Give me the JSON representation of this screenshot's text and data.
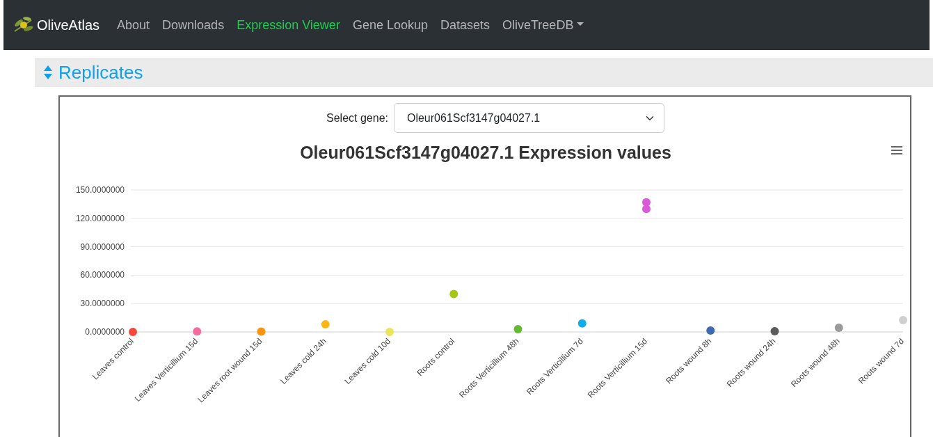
{
  "navbar": {
    "brand": "OliveAtlas",
    "links": [
      {
        "label": "About",
        "selected": false
      },
      {
        "label": "Downloads",
        "selected": false
      },
      {
        "label": "Expression Viewer",
        "selected": true
      },
      {
        "label": "Gene Lookup",
        "selected": false
      },
      {
        "label": "Datasets",
        "selected": false
      },
      {
        "label": "OliveTreeDB",
        "selected": false,
        "kind": "dropdown"
      }
    ]
  },
  "section": {
    "title": "Replicates"
  },
  "gene_select": {
    "label": "Select gene:",
    "value": "Oleur061Scf3147g04027.1"
  },
  "chart_data": {
    "type": "scatter",
    "title": "Oleur061Scf3147g04027.1 Expression values",
    "categories": [
      "Leaves control",
      "Leaves Verticillium 15d",
      "Leaves root wound 15d",
      "Leaves cold 24h",
      "Leaves cold 10d",
      "Roots control",
      "Roots Verticillium 48h",
      "Roots Verticillium 7d",
      "Roots Verticillium 15d",
      "Roots wound 8h",
      "Roots wound 24h",
      "Roots wound 48h",
      "Roots wound 7d"
    ],
    "ylim": [
      0,
      150
    ],
    "grid": true,
    "yticks": [
      {
        "value": 0,
        "label": "0.0000000"
      },
      {
        "value": 30,
        "label": "30.0000000"
      },
      {
        "value": 60,
        "label": "60.0000000"
      },
      {
        "value": 90,
        "label": "90.0000000"
      },
      {
        "value": 120,
        "label": "120.0000000"
      },
      {
        "value": 150,
        "label": "150.0000000"
      }
    ],
    "series": [
      {
        "colors": [
          "#f5483b",
          "#f66aa0",
          "#f7950e",
          "#fbb614",
          "#ece55a",
          "#a5c614",
          "#62bb32",
          "#10aee8",
          "#d959d6",
          "#3e68b0",
          "#5b5b5b",
          "#9a9a9a",
          "#cfcfcf"
        ],
        "values": [
          0,
          0.5,
          0.3,
          8,
          0,
          40,
          3,
          9,
          137,
          1.5,
          0.7,
          4.4,
          12.5
        ]
      },
      {
        "colors": [
          null,
          null,
          null,
          null,
          null,
          null,
          null,
          null,
          "#d959d6",
          null,
          null,
          null,
          null
        ],
        "values": [
          null,
          null,
          null,
          null,
          null,
          null,
          null,
          null,
          130,
          null,
          null,
          null,
          null
        ]
      }
    ]
  }
}
